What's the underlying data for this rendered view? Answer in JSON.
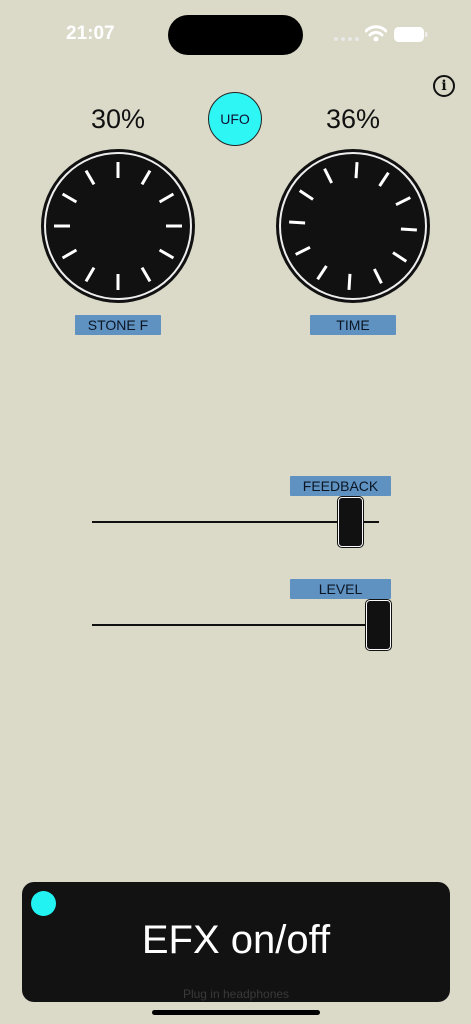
{
  "status_bar": {
    "time": "21:07"
  },
  "header": {
    "info_glyph": "i",
    "mode_button": "UFO"
  },
  "knobs": [
    {
      "label": "STONE F",
      "value": "30%",
      "percent": 30
    },
    {
      "label": "TIME",
      "value": "36%",
      "percent": 36
    }
  ],
  "sliders": [
    {
      "label": "FEEDBACK",
      "value_fraction": 0.88
    },
    {
      "label": "LEVEL",
      "value_fraction": 1.0
    }
  ],
  "efx": {
    "label": "EFX on/off",
    "hint": "Plug in headphones",
    "indicator_color": "#22f3f2"
  },
  "colors": {
    "background": "#dbd9c8",
    "accent": "#2ef6f5",
    "tag": "#5f91c1"
  },
  "icons": [
    "wifi-icon",
    "battery-icon",
    "info-icon"
  ]
}
